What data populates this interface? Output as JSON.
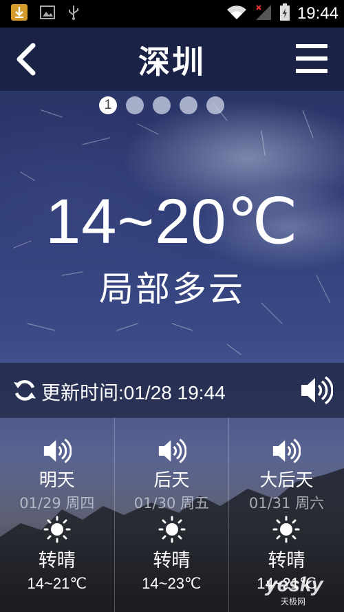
{
  "status_bar": {
    "time": "19:44",
    "icons": [
      "download-icon",
      "image-icon",
      "usb-icon",
      "wifi-icon",
      "signal-icon",
      "battery-icon"
    ]
  },
  "header": {
    "city": "深圳",
    "page_indicator": {
      "current": "1",
      "total": 5
    }
  },
  "weather": {
    "temp_range": "14~20℃",
    "condition": "局部多云"
  },
  "update": {
    "text": "更新时间:01/28 19:44"
  },
  "forecast": [
    {
      "day": "明天",
      "date": "01/29 周四",
      "icon": "sunny-icon",
      "condition": "转晴",
      "temp": "14~21℃"
    },
    {
      "day": "后天",
      "date": "01/30 周五",
      "icon": "sunny-icon",
      "condition": "转晴",
      "temp": "14~23℃"
    },
    {
      "day": "大后天",
      "date": "01/31 周六",
      "icon": "sunny-icon",
      "condition": "转晴",
      "temp": "14~21℃"
    }
  ],
  "watermark": {
    "brand": "yesky",
    "sub": "天极网"
  },
  "colors": {
    "status_bar": "#000000",
    "sky_top": "#27305d",
    "sky_mid": "#3b4a88",
    "text": "#ffffff"
  }
}
